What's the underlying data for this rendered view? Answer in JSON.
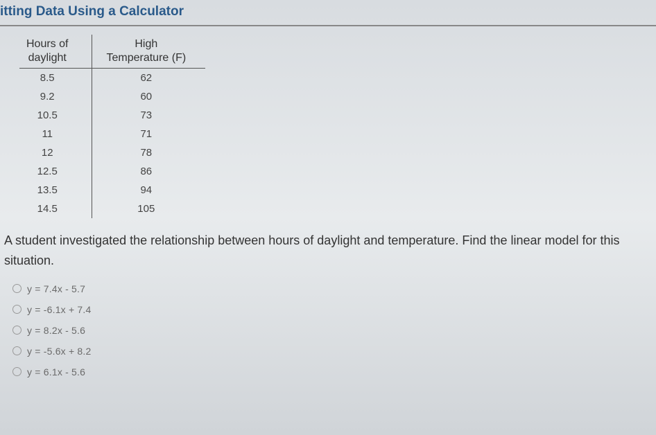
{
  "header": {
    "title": "itting Data Using a Calculator"
  },
  "table": {
    "col1_header_line1": "Hours of",
    "col1_header_line2": "daylight",
    "col2_header_line1": "High",
    "col2_header_line2": "Temperature (F)",
    "rows": [
      {
        "hours": "8.5",
        "temp": "62"
      },
      {
        "hours": "9.2",
        "temp": "60"
      },
      {
        "hours": "10.5",
        "temp": "73"
      },
      {
        "hours": "11",
        "temp": "71"
      },
      {
        "hours": "12",
        "temp": "78"
      },
      {
        "hours": "12.5",
        "temp": "86"
      },
      {
        "hours": "13.5",
        "temp": "94"
      },
      {
        "hours": "14.5",
        "temp": "105"
      }
    ]
  },
  "prompt": "A student investigated the relationship between hours of daylight and temperature. Find the linear model for this situation.",
  "options": [
    {
      "label": "y = 7.4x - 5.7"
    },
    {
      "label": "y = -6.1x + 7.4"
    },
    {
      "label": "y = 8.2x - 5.6"
    },
    {
      "label": "y = -5.6x + 8.2"
    },
    {
      "label": "y = 6.1x - 5.6"
    }
  ],
  "chart_data": {
    "type": "table",
    "title": "Hours of daylight vs High Temperature (F)",
    "columns": [
      "Hours of daylight",
      "High Temperature (F)"
    ],
    "data": [
      [
        8.5,
        62
      ],
      [
        9.2,
        60
      ],
      [
        10.5,
        73
      ],
      [
        11,
        71
      ],
      [
        12,
        78
      ],
      [
        12.5,
        86
      ],
      [
        13.5,
        94
      ],
      [
        14.5,
        105
      ]
    ]
  }
}
